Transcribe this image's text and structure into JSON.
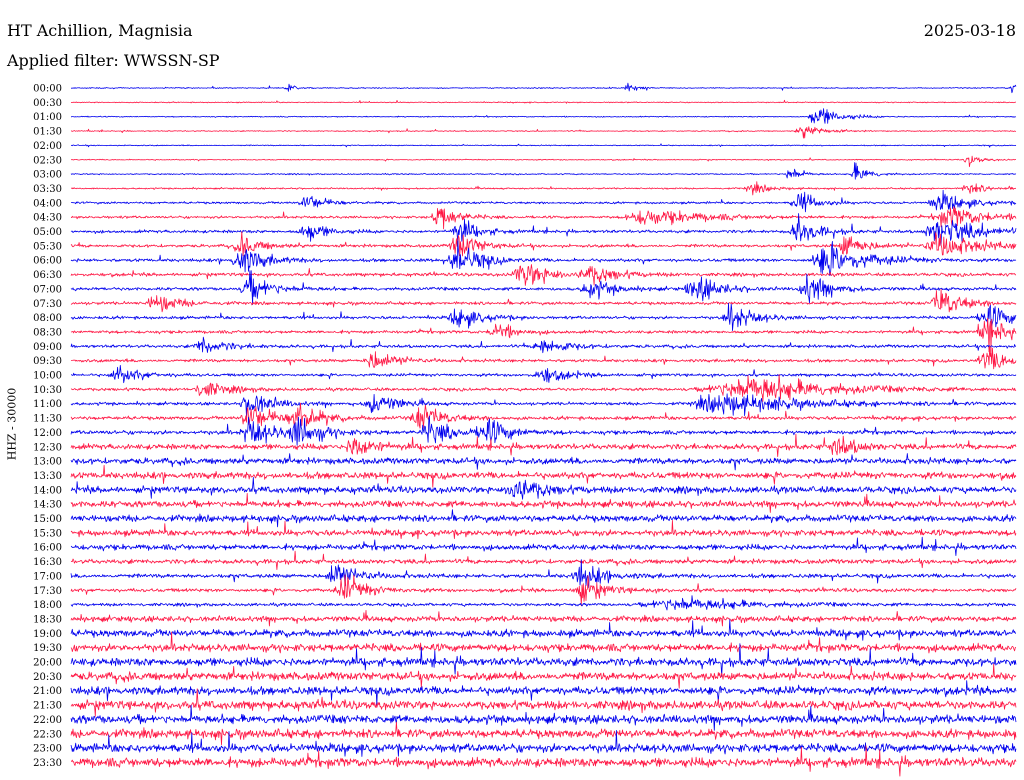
{
  "header": {
    "station": "HT Achillion, Magnisia",
    "date": "2025-03-18",
    "filter_label": "Applied filter:",
    "filter_value": "WWSSN-SP"
  },
  "axis": {
    "ylabel": "HHZ - 30000"
  },
  "colors": {
    "trace_a": "#0000ee",
    "trace_b": "#ff1744"
  },
  "chart_data": {
    "type": "line",
    "title": "HT Achillion, Magnisia",
    "subtitle": "Applied filter: WWSSN-SP",
    "ylabel": "HHZ - 30000",
    "date": "2025-03-18",
    "row_interval_minutes": 30,
    "grid": false,
    "rows": [
      {
        "label": "00:00",
        "noise": 1.0,
        "events": [
          {
            "pos": 0.23,
            "amp": 5,
            "width": 0.004
          },
          {
            "pos": 0.59,
            "amp": 4,
            "width": 0.005
          },
          {
            "pos": 0.995,
            "amp": 6,
            "width": 0.003
          }
        ]
      },
      {
        "label": "00:30",
        "noise": 1.0,
        "events": []
      },
      {
        "label": "01:00",
        "noise": 1.0,
        "events": [
          {
            "pos": 0.79,
            "amp": 10,
            "width": 0.012
          }
        ]
      },
      {
        "label": "01:30",
        "noise": 1.0,
        "events": [
          {
            "pos": 0.775,
            "amp": 7,
            "width": 0.01
          }
        ]
      },
      {
        "label": "02:00",
        "noise": 1.0,
        "events": []
      },
      {
        "label": "02:30",
        "noise": 1.0,
        "events": [
          {
            "pos": 0.95,
            "amp": 6,
            "width": 0.006
          }
        ]
      },
      {
        "label": "03:00",
        "noise": 1.2,
        "events": [
          {
            "pos": 0.76,
            "amp": 8,
            "width": 0.006
          },
          {
            "pos": 0.83,
            "amp": 9,
            "width": 0.008
          }
        ]
      },
      {
        "label": "03:30",
        "noise": 1.5,
        "events": [
          {
            "pos": 0.72,
            "amp": 5,
            "width": 0.01
          },
          {
            "pos": 0.95,
            "amp": 5,
            "width": 0.01
          }
        ]
      },
      {
        "label": "04:00",
        "noise": 2.2,
        "events": [
          {
            "pos": 0.25,
            "amp": 8,
            "width": 0.01
          },
          {
            "pos": 0.77,
            "amp": 10,
            "width": 0.01
          },
          {
            "pos": 0.92,
            "amp": 9,
            "width": 0.015
          }
        ]
      },
      {
        "label": "04:30",
        "noise": 2.5,
        "events": [
          {
            "pos": 0.39,
            "amp": 12,
            "width": 0.01
          },
          {
            "pos": 0.61,
            "amp": 8,
            "width": 0.03
          },
          {
            "pos": 0.93,
            "amp": 10,
            "width": 0.02
          }
        ]
      },
      {
        "label": "05:00",
        "noise": 3.0,
        "events": [
          {
            "pos": 0.25,
            "amp": 9,
            "width": 0.01
          },
          {
            "pos": 0.41,
            "amp": 12,
            "width": 0.01
          },
          {
            "pos": 0.77,
            "amp": 14,
            "width": 0.01
          },
          {
            "pos": 0.92,
            "amp": 14,
            "width": 0.02
          }
        ]
      },
      {
        "label": "05:30",
        "noise": 3.0,
        "events": [
          {
            "pos": 0.18,
            "amp": 10,
            "width": 0.01
          },
          {
            "pos": 0.41,
            "amp": 14,
            "width": 0.01
          },
          {
            "pos": 0.82,
            "amp": 12,
            "width": 0.01
          },
          {
            "pos": 0.92,
            "amp": 12,
            "width": 0.02
          }
        ]
      },
      {
        "label": "06:00",
        "noise": 3.2,
        "events": [
          {
            "pos": 0.18,
            "amp": 14,
            "width": 0.012
          },
          {
            "pos": 0.41,
            "amp": 16,
            "width": 0.012
          },
          {
            "pos": 0.8,
            "amp": 16,
            "width": 0.02
          }
        ]
      },
      {
        "label": "06:30",
        "noise": 3.2,
        "events": [
          {
            "pos": 0.48,
            "amp": 12,
            "width": 0.015
          },
          {
            "pos": 0.55,
            "amp": 8,
            "width": 0.015
          }
        ]
      },
      {
        "label": "07:00",
        "noise": 3.2,
        "events": [
          {
            "pos": 0.19,
            "amp": 13,
            "width": 0.012
          },
          {
            "pos": 0.55,
            "amp": 9,
            "width": 0.012
          },
          {
            "pos": 0.66,
            "amp": 14,
            "width": 0.012
          },
          {
            "pos": 0.78,
            "amp": 14,
            "width": 0.012
          }
        ]
      },
      {
        "label": "07:30",
        "noise": 3.0,
        "events": [
          {
            "pos": 0.09,
            "amp": 9,
            "width": 0.012
          },
          {
            "pos": 0.92,
            "amp": 14,
            "width": 0.012
          }
        ]
      },
      {
        "label": "08:00",
        "noise": 3.0,
        "events": [
          {
            "pos": 0.41,
            "amp": 10,
            "width": 0.012
          },
          {
            "pos": 0.7,
            "amp": 12,
            "width": 0.012
          },
          {
            "pos": 0.97,
            "amp": 12,
            "width": 0.012
          }
        ]
      },
      {
        "label": "08:30",
        "noise": 3.0,
        "events": [
          {
            "pos": 0.45,
            "amp": 9,
            "width": 0.01
          },
          {
            "pos": 0.97,
            "amp": 14,
            "width": 0.012
          }
        ]
      },
      {
        "label": "09:00",
        "noise": 3.0,
        "events": [
          {
            "pos": 0.14,
            "amp": 8,
            "width": 0.012
          },
          {
            "pos": 0.5,
            "amp": 9,
            "width": 0.012
          }
        ]
      },
      {
        "label": "09:30",
        "noise": 3.0,
        "events": [
          {
            "pos": 0.32,
            "amp": 9,
            "width": 0.012
          },
          {
            "pos": 0.97,
            "amp": 12,
            "width": 0.012
          }
        ]
      },
      {
        "label": "10:00",
        "noise": 2.8,
        "events": [
          {
            "pos": 0.05,
            "amp": 8,
            "width": 0.012
          },
          {
            "pos": 0.5,
            "amp": 8,
            "width": 0.012
          }
        ]
      },
      {
        "label": "10:30",
        "noise": 3.0,
        "events": [
          {
            "pos": 0.14,
            "amp": 8,
            "width": 0.012
          },
          {
            "pos": 0.7,
            "amp": 7,
            "width": 0.04
          },
          {
            "pos": 0.73,
            "amp": 7,
            "width": 0.04
          }
        ]
      },
      {
        "label": "11:00",
        "noise": 3.0,
        "events": [
          {
            "pos": 0.19,
            "amp": 12,
            "width": 0.012
          },
          {
            "pos": 0.32,
            "amp": 11,
            "width": 0.012
          },
          {
            "pos": 0.69,
            "amp": 10,
            "width": 0.04
          }
        ]
      },
      {
        "label": "11:30",
        "noise": 3.5,
        "events": [
          {
            "pos": 0.19,
            "amp": 14,
            "width": 0.012
          },
          {
            "pos": 0.24,
            "amp": 13,
            "width": 0.012
          },
          {
            "pos": 0.37,
            "amp": 12,
            "width": 0.012
          }
        ]
      },
      {
        "label": "12:00",
        "noise": 4.0,
        "events": [
          {
            "pos": 0.19,
            "amp": 14,
            "width": 0.012
          },
          {
            "pos": 0.24,
            "amp": 14,
            "width": 0.012
          },
          {
            "pos": 0.38,
            "amp": 12,
            "width": 0.012
          },
          {
            "pos": 0.44,
            "amp": 12,
            "width": 0.012
          }
        ]
      },
      {
        "label": "12:30",
        "noise": 5.5,
        "events": [
          {
            "pos": 0.3,
            "amp": 12,
            "width": 0.01
          },
          {
            "pos": 0.81,
            "amp": 10,
            "width": 0.01
          }
        ]
      },
      {
        "label": "13:00",
        "noise": 6.0,
        "events": []
      },
      {
        "label": "13:30",
        "noise": 6.5,
        "events": []
      },
      {
        "label": "14:00",
        "noise": 6.5,
        "events": [
          {
            "pos": 0.47,
            "amp": 14,
            "width": 0.012
          }
        ]
      },
      {
        "label": "14:30",
        "noise": 6.5,
        "events": []
      },
      {
        "label": "15:00",
        "noise": 6.5,
        "events": []
      },
      {
        "label": "15:30",
        "noise": 6.0,
        "events": []
      },
      {
        "label": "16:00",
        "noise": 5.5,
        "events": []
      },
      {
        "label": "16:30",
        "noise": 4.5,
        "events": []
      },
      {
        "label": "17:00",
        "noise": 4.0,
        "events": [
          {
            "pos": 0.28,
            "amp": 12,
            "width": 0.012
          },
          {
            "pos": 0.54,
            "amp": 12,
            "width": 0.012
          }
        ]
      },
      {
        "label": "17:30",
        "noise": 3.5,
        "events": [
          {
            "pos": 0.29,
            "amp": 12,
            "width": 0.012
          },
          {
            "pos": 0.54,
            "amp": 12,
            "width": 0.012
          }
        ]
      },
      {
        "label": "18:00",
        "noise": 3.0,
        "events": [
          {
            "pos": 0.64,
            "amp": 6,
            "width": 0.04
          }
        ]
      },
      {
        "label": "18:30",
        "noise": 5.5,
        "events": []
      },
      {
        "label": "19:00",
        "noise": 7.0,
        "events": []
      },
      {
        "label": "19:30",
        "noise": 7.5,
        "events": []
      },
      {
        "label": "20:00",
        "noise": 8.0,
        "events": []
      },
      {
        "label": "20:30",
        "noise": 8.0,
        "events": []
      },
      {
        "label": "21:00",
        "noise": 8.0,
        "events": []
      },
      {
        "label": "21:30",
        "noise": 8.5,
        "events": []
      },
      {
        "label": "22:00",
        "noise": 8.5,
        "events": []
      },
      {
        "label": "22:30",
        "noise": 8.5,
        "events": []
      },
      {
        "label": "23:00",
        "noise": 8.5,
        "events": []
      },
      {
        "label": "23:30",
        "noise": 9.0,
        "events": []
      }
    ]
  }
}
